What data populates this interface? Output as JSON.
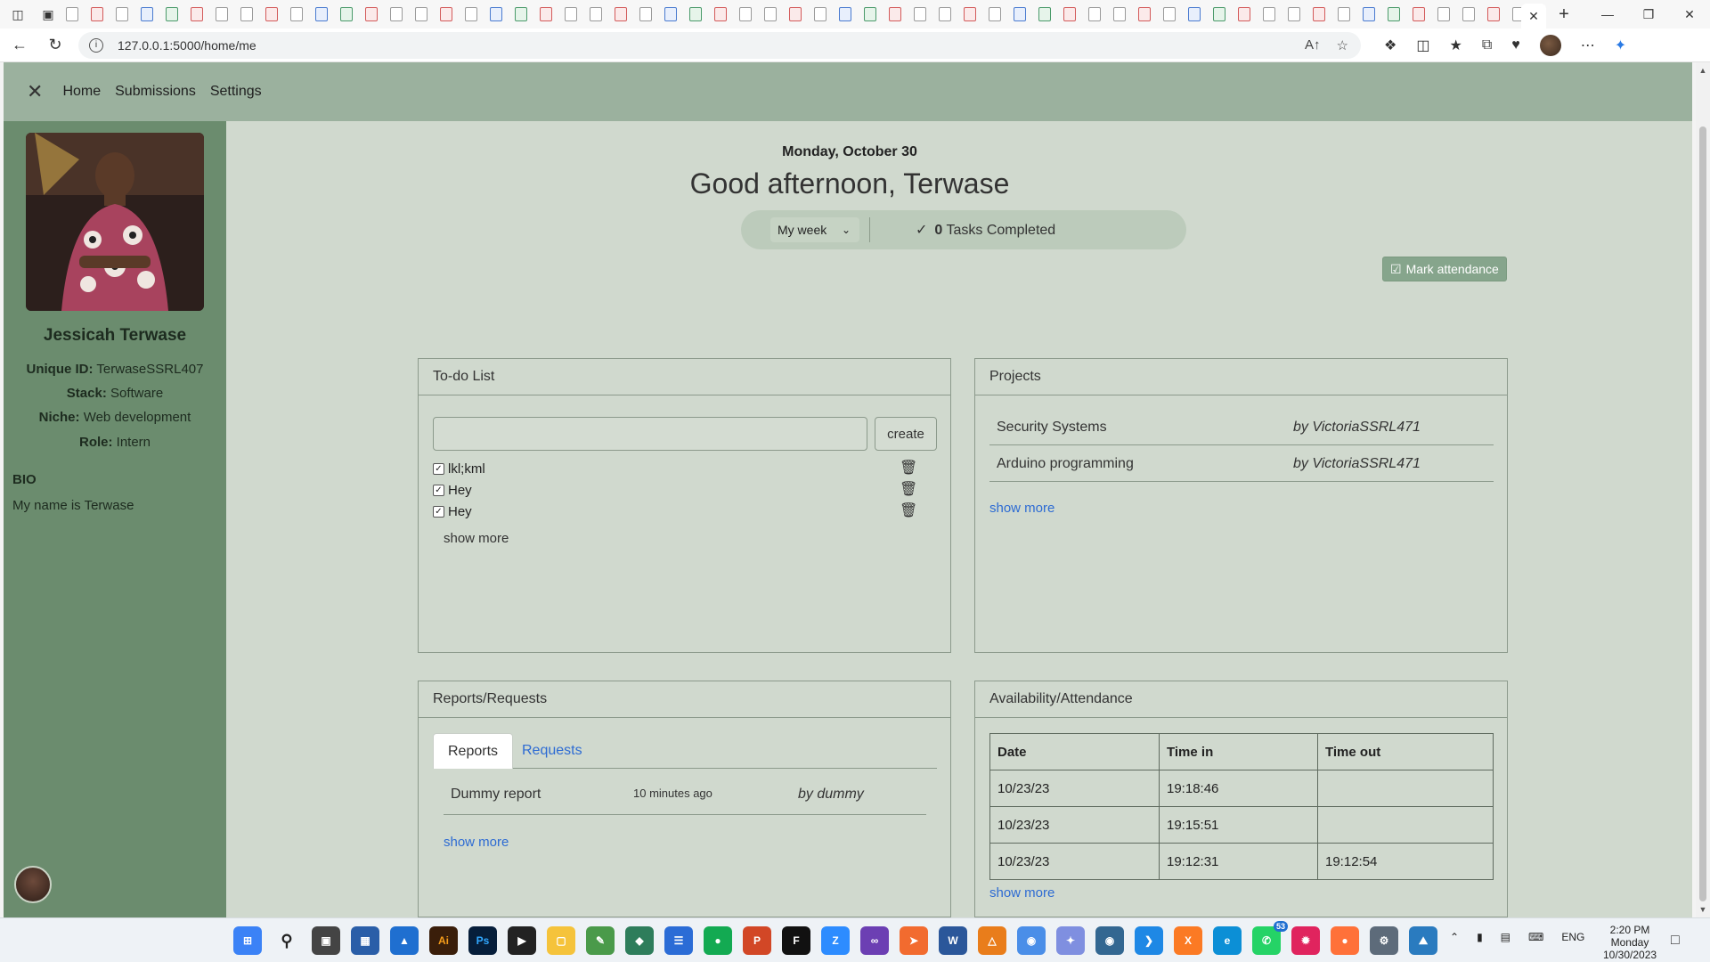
{
  "browser": {
    "url": "127.0.0.1:5000/home/me",
    "tab_count_icons": 60
  },
  "topnav": {
    "links": [
      "Home",
      "Submissions",
      "Settings"
    ]
  },
  "profile": {
    "name": "Jessicah Terwase",
    "fields": [
      {
        "label": "Unique ID:",
        "value": "TerwaseSSRL407"
      },
      {
        "label": "Stack:",
        "value": "Software"
      },
      {
        "label": "Niche:",
        "value": "Web development"
      },
      {
        "label": "Role:",
        "value": "Intern"
      }
    ],
    "bio_heading": "BIO",
    "bio_text": "My name is Terwase"
  },
  "header": {
    "date": "Monday, October 30",
    "greeting": "Good afternoon, Terwase",
    "period_select": "My week",
    "tasks_count": "0",
    "tasks_label": "Tasks Completed",
    "mark_attendance": "Mark attendance"
  },
  "todo": {
    "title": "To-do List",
    "input_value": "",
    "create_label": "create",
    "items": [
      {
        "text": "lkl;kml",
        "checked": true
      },
      {
        "text": "Hey",
        "checked": true
      },
      {
        "text": "Hey",
        "checked": true
      }
    ],
    "show_more": "show more"
  },
  "projects": {
    "title": "Projects",
    "items": [
      {
        "name": "Security Systems",
        "by": "by VictoriaSSRL471"
      },
      {
        "name": "Arduino programming",
        "by": "by VictoriaSSRL471"
      }
    ],
    "show_more": "show more"
  },
  "reports": {
    "title": "Reports/Requests",
    "tabs": [
      "Reports",
      "Requests"
    ],
    "active_tab": "Reports",
    "items": [
      {
        "title": "Dummy report",
        "time": "10 minutes ago",
        "by": "by dummy"
      }
    ],
    "show_more": "show more"
  },
  "attendance": {
    "title": "Availability/Attendance",
    "columns": [
      "Date",
      "Time in",
      "Time out"
    ],
    "rows": [
      [
        "10/23/23",
        "19:18:46",
        ""
      ],
      [
        "10/23/23",
        "19:15:51",
        ""
      ],
      [
        "10/23/23",
        "19:12:31",
        "19:12:54"
      ]
    ],
    "show_more": "show more"
  },
  "taskbar": {
    "language": "ENG",
    "time": "2:20 PM",
    "day": "Monday",
    "date": "10/30/2023",
    "whatsapp_badge": "53"
  },
  "colors": {
    "page_bg": "#d0d9ce",
    "sidebar_bg": "#6b8c6e",
    "topnav_bg": "#9bb19e",
    "link": "#2d6bd3",
    "mark_button": "#86a58c"
  }
}
